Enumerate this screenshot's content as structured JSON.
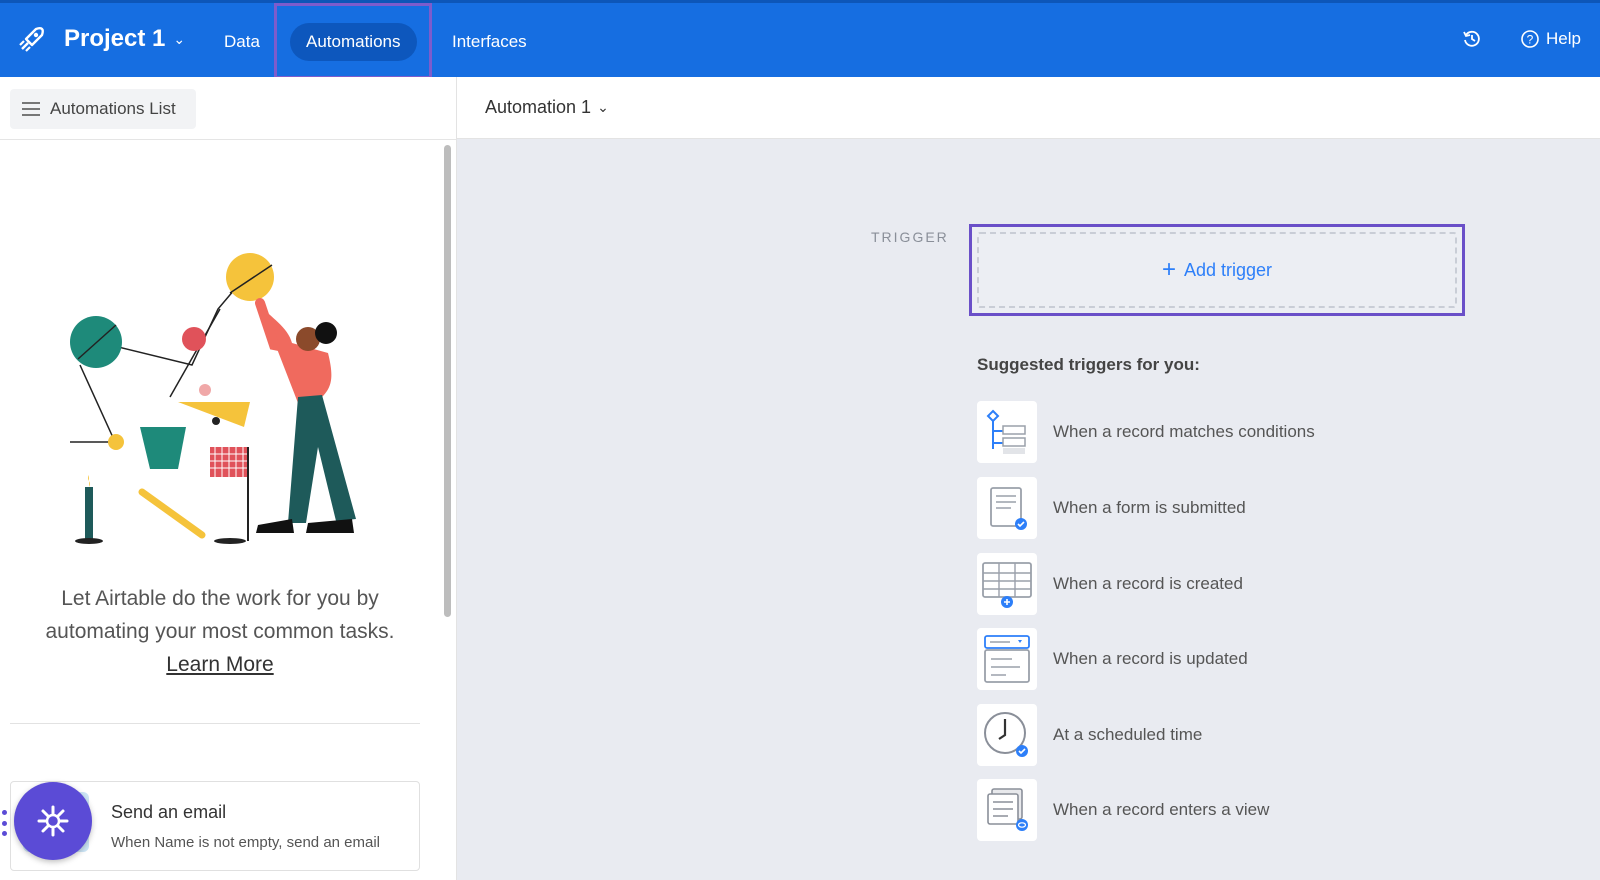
{
  "header": {
    "project_name": "Project 1",
    "nav": {
      "data": "Data",
      "automations": "Automations",
      "interfaces": "Interfaces"
    },
    "help": "Help"
  },
  "left_panel": {
    "automations_list": "Automations List",
    "intro_text": "Let Airtable do the work for you by automating your most common tasks.",
    "learn_more": "Learn More",
    "card": {
      "title": "Send an email",
      "subtitle": "When Name is not empty, send an email"
    }
  },
  "main": {
    "automation_name": "Automation 1",
    "trigger_label": "TRIGGER",
    "add_trigger": "Add trigger",
    "suggested_title": "Suggested triggers for you:",
    "suggestions": [
      {
        "label": "When a record matches conditions",
        "icon": "conditions-icon"
      },
      {
        "label": "When a form is submitted",
        "icon": "form-submitted-icon"
      },
      {
        "label": "When a record is created",
        "icon": "record-created-icon"
      },
      {
        "label": "When a record is updated",
        "icon": "record-updated-icon"
      },
      {
        "label": "At a scheduled time",
        "icon": "clock-icon"
      },
      {
        "label": "When a record enters a view",
        "icon": "view-icon"
      }
    ]
  },
  "colors": {
    "topbar": "#166ee1",
    "active_tab": "#0d57bd",
    "highlight_frame": "#6a4fc8",
    "link_blue": "#2d7ff9",
    "canvas_bg": "#e9ebf1"
  }
}
